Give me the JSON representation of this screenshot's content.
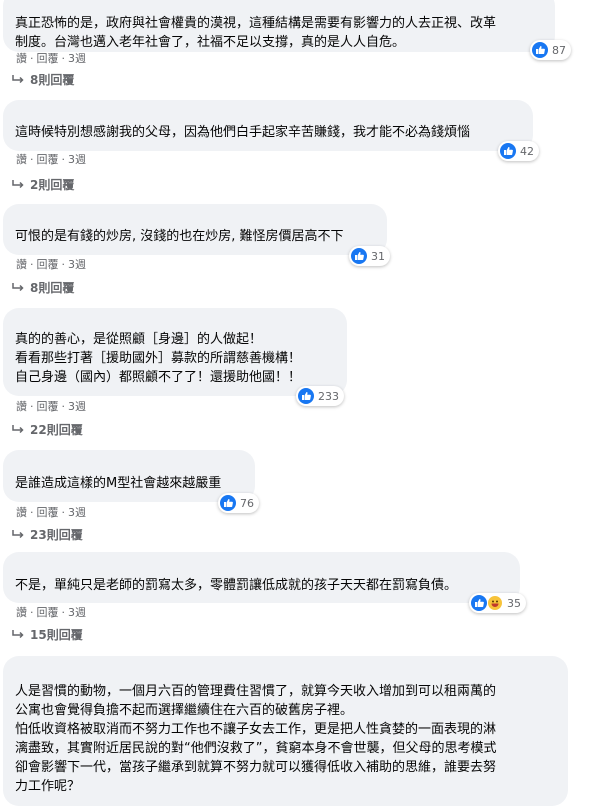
{
  "actions": {
    "like": "讚",
    "reply": "回覆",
    "dot": "·"
  },
  "comments": [
    {
      "author": "",
      "text": "真正恐怖的是，政府與社會權貴的漠視，這種結構是需要有影響力的人去正視、改革\n制度。台灣也邁入老年社會了，社福不足以支撐，真的是人人自危。",
      "likes": "87",
      "time": "3週",
      "replies": "8則回覆"
    },
    {
      "author": "",
      "text": "這時候特別想感謝我的父母，因為他們白手起家辛苦賺錢，我才能不必為錢煩惱",
      "likes": "42",
      "time": "3週",
      "replies": "2則回覆"
    },
    {
      "author": "",
      "text": "可恨的是有錢的炒房, 沒錢的也在炒房, 難怪房價居高不下",
      "likes": "31",
      "time": "3週",
      "replies": "8則回覆"
    },
    {
      "author": "",
      "text": "真的的善心，是從照顧［身邊］的人做起！\n看看那些打著［援助國外］募款的所謂慈善機構！\n自己身邊（國內）都照顧不了了！還援助他國！！",
      "likes": "233",
      "time": "3週",
      "replies": "22則回覆"
    },
    {
      "author": "",
      "text": "是誰造成這樣的M型社會越來越嚴重",
      "likes": "76",
      "time": "3週",
      "replies": "23則回覆"
    },
    {
      "author": "",
      "text": "不是，單純只是老師的罰寫太多，零體罰讓低成就的孩子天天都在罰寫負債。",
      "likes": "35",
      "time": "3週",
      "replies": "15則回覆"
    },
    {
      "author": "",
      "text": "人是習慣的動物，一個月六百的管理費住習慣了，就算今天收入增加到可以租兩萬的\n公寓也會覺得負擔不起而選擇繼續住在六百的破舊房子裡。\n怕低收資格被取消而不努力工作也不讓子女去工作，更是把人性貪婪的一面表現的淋\n漓盡致，其實附近居民說的對“他們沒救了”，貧窮本身不會世襲，但父母的思考模式\n卻會影響下一代，當孩子繼承到就算不努力就可以獲得低收入補助的思維，誰要去努\n力工作呢？"
    }
  ]
}
